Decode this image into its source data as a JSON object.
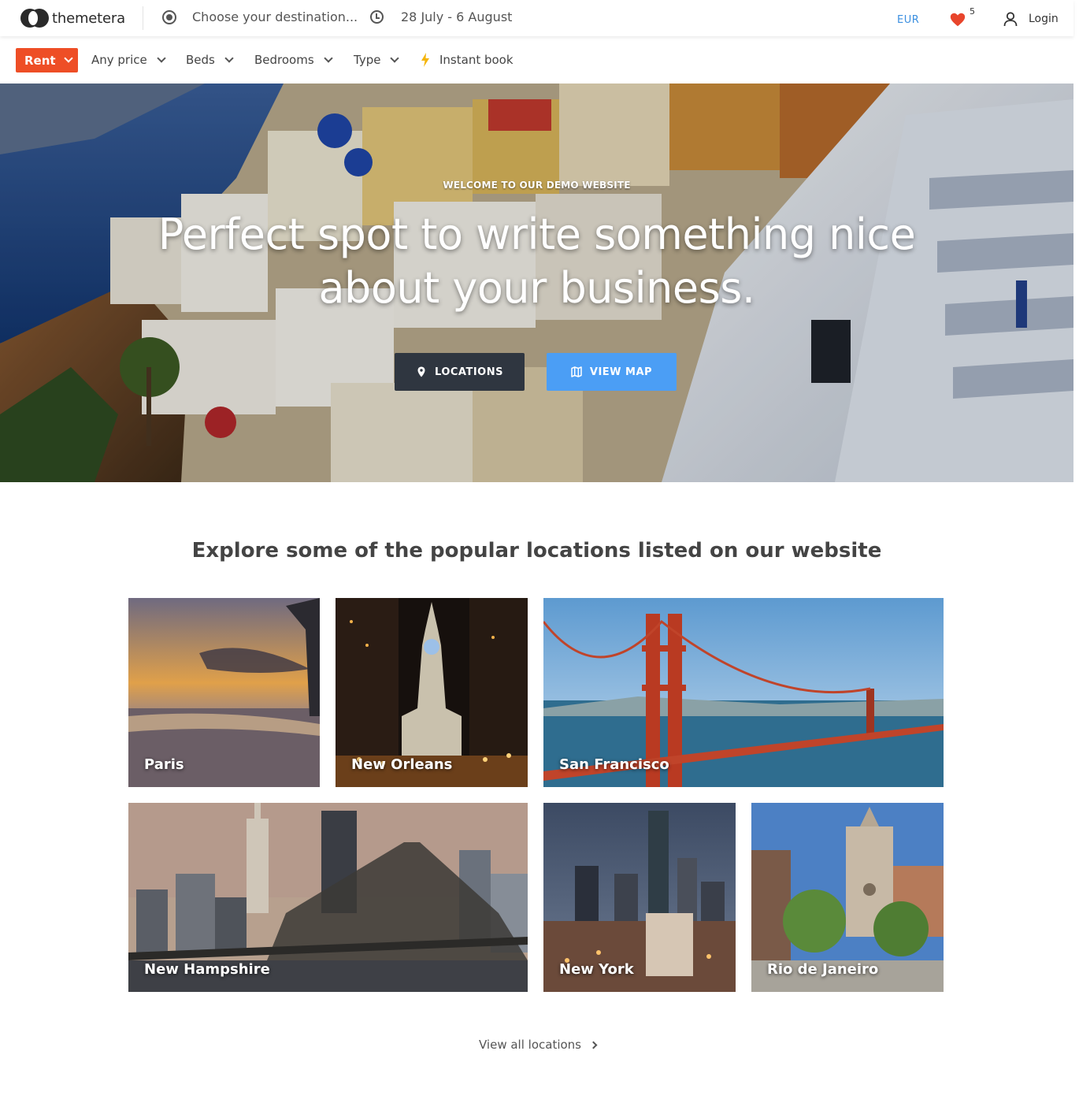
{
  "header": {
    "logo_text": "themetera",
    "destination_placeholder": "Choose your destination...",
    "dates": "28 July - 6 August",
    "currency": "EUR",
    "favorites_count": "5",
    "login_label": "Login"
  },
  "filters": {
    "rent_label": "Rent",
    "price_label": "Any price",
    "beds_label": "Beds",
    "bedrooms_label": "Bedrooms",
    "type_label": "Type",
    "instant_book_label": "Instant book"
  },
  "hero": {
    "kicker": "WELCOME TO OUR DEMO WEBSITE",
    "title": "Perfect spot to write something nice about your business.",
    "locations_button": "LOCATIONS",
    "view_map_button": "VIEW MAP"
  },
  "locations": {
    "section_title": "Explore some of the popular locations listed on our website",
    "items": [
      {
        "name": "Paris"
      },
      {
        "name": "New Orleans"
      },
      {
        "name": "San Francisco"
      },
      {
        "name": "New Hampshire"
      },
      {
        "name": "New York"
      },
      {
        "name": "Rio de Janeiro"
      }
    ],
    "view_all_label": "View all locations"
  },
  "colors": {
    "accent_orange": "#ee4e26",
    "accent_blue": "#4b9ef5",
    "dark_button": "#2f3640",
    "favorite_red": "#e8452c",
    "currency_blue": "#3b8fe0"
  }
}
